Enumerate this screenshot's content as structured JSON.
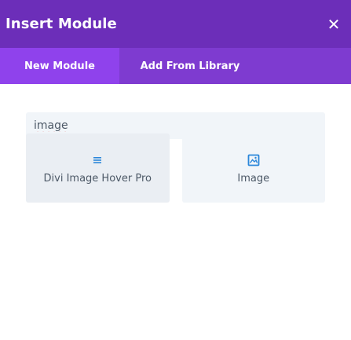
{
  "header": {
    "title": "Insert Module",
    "close_glyph": "✕"
  },
  "tabs": [
    {
      "label": "New Module",
      "active": true
    },
    {
      "label": "Add From Library",
      "active": false
    }
  ],
  "search": {
    "value": "image",
    "placeholder": ""
  },
  "modules": [
    {
      "label": "Divi Image Hover Pro",
      "icon": "hamburger-menu-icon"
    },
    {
      "label": "Image",
      "icon": "image-icon"
    }
  ],
  "colors": {
    "header_bg": "#6c2eb9",
    "tabs_bg": "#7e3bd0",
    "active_tab_bg": "#8f42ec",
    "icon_blue": "#2b87da",
    "card_bg": "#f1f5f9"
  }
}
